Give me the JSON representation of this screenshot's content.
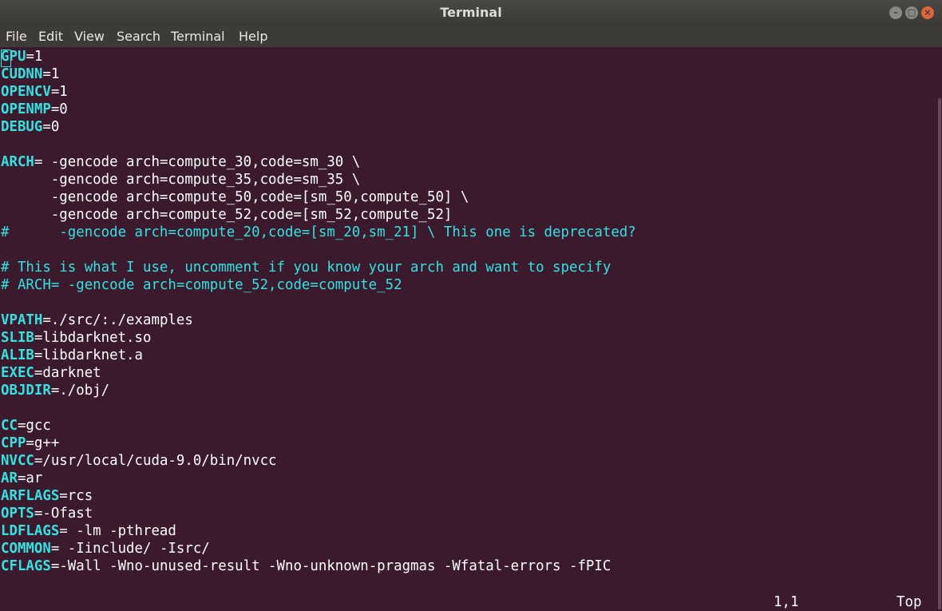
{
  "window": {
    "title": "Terminal"
  },
  "menu": [
    "File",
    "Edit",
    "View",
    "Search",
    "Terminal",
    "Help"
  ],
  "lines": [
    {
      "key": "GPU",
      "rest": "=1"
    },
    {
      "key": "CUDNN",
      "rest": "=1"
    },
    {
      "key": "OPENCV",
      "rest": "=1"
    },
    {
      "key": "OPENMP",
      "rest": "=0"
    },
    {
      "key": "DEBUG",
      "rest": "=0"
    },
    {
      "key": "",
      "rest": ""
    },
    {
      "key": "ARCH",
      "rest": "= -gencode arch=compute_30,code=sm_30 \\"
    },
    {
      "key": "",
      "rest": "      -gencode arch=compute_35,code=sm_35 \\"
    },
    {
      "key": "",
      "rest": "      -gencode arch=compute_50,code=[sm_50,compute_50] \\"
    },
    {
      "key": "",
      "rest": "      -gencode arch=compute_52,code=[sm_52,compute_52]"
    },
    {
      "comment": "#      -gencode arch=compute_20,code=[sm_20,sm_21] \\ This one is deprecated?"
    },
    {
      "key": "",
      "rest": ""
    },
    {
      "comment": "# This is what I use, uncomment if you know your arch and want to specify"
    },
    {
      "comment": "# ARCH= -gencode arch=compute_52,code=compute_52"
    },
    {
      "key": "",
      "rest": ""
    },
    {
      "key": "VPATH",
      "rest": "=./src/:./examples"
    },
    {
      "key": "SLIB",
      "rest": "=libdarknet.so"
    },
    {
      "key": "ALIB",
      "rest": "=libdarknet.a"
    },
    {
      "key": "EXEC",
      "rest": "=darknet"
    },
    {
      "key": "OBJDIR",
      "rest": "=./obj/"
    },
    {
      "key": "",
      "rest": ""
    },
    {
      "key": "CC",
      "rest": "=gcc"
    },
    {
      "key": "CPP",
      "rest": "=g++"
    },
    {
      "key": "NVCC",
      "rest": "=/usr/local/cuda-9.0/bin/nvcc"
    },
    {
      "key": "AR",
      "rest": "=ar"
    },
    {
      "key": "ARFLAGS",
      "rest": "=rcs"
    },
    {
      "key": "OPTS",
      "rest": "=-Ofast"
    },
    {
      "key": "LDFLAGS",
      "rest": "= -lm -pthread"
    },
    {
      "key": "COMMON",
      "rest": "= -Iinclude/ -Isrc/"
    },
    {
      "key": "CFLAGS",
      "rest": "=-Wall -Wno-unused-result -Wno-unknown-pragmas -Wfatal-errors -fPIC"
    }
  ],
  "status": {
    "position": "1,1",
    "scroll": "Top"
  }
}
